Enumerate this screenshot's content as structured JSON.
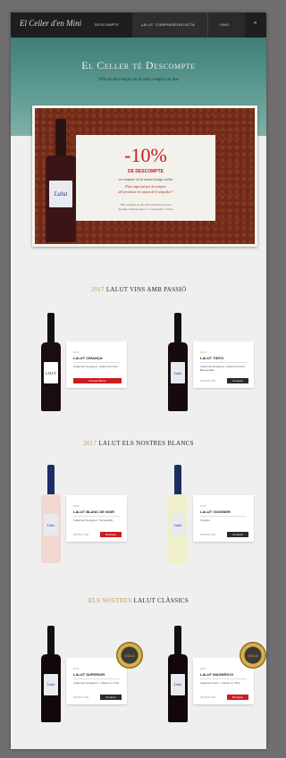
{
  "header": {
    "logo": "El Celler d'en Mini",
    "nav": [
      "DESCOMPTE",
      "LALUT",
      "COMPRAR",
      "CONTACTA",
      "VINS"
    ],
    "more": "»"
  },
  "hero": {
    "title": "El Celler té Descompte",
    "subtitle": "10% de descompte en la seva compra on line"
  },
  "promo": {
    "bottle_label": "Lalut",
    "percent": "-10%",
    "headline": "DE DESCOMPTE",
    "line1": "en comprar en la nostra botiga online",
    "line2": "Preu especial per la compra",
    "line3": "del producte en caixes de 6 ampolles*",
    "fine1": "*Els comptes no són fets mai sobre el preu",
    "fine2": "Sumats 2 Descomptes = 1 Comanda = 1 Preu"
  },
  "sections": [
    {
      "year": "2017",
      "title": "LALUT VINS AMB PASSIÓ",
      "products": [
        {
          "year": "2013",
          "name": "LALUT CRIANÇA",
          "grapes": "Cabernet Sauvignon, Cabernet Franc",
          "button": "Paraula Beure"
        },
        {
          "year": "2014",
          "name": "LALUT TINTO",
          "grapes": "Cabernet Sauvignon, Cabernet Franc, Bosquedilla",
          "price": "13,35 € / IVA",
          "button": "Comprar"
        }
      ]
    },
    {
      "year": "2017",
      "title": "LALUT ELS NOSTRES BLANCS",
      "products": [
        {
          "year": "2016",
          "name": "LALUT BLANC DE NOIR",
          "grapes": "Cabernet Sauvignon, Tempranillo",
          "price": "12,85 € / IVA",
          "button": "Boutique"
        },
        {
          "year": "2016",
          "name": "LALUT VIOGNIER",
          "grapes": "Viognier",
          "price": "13,85 € / IVA",
          "button": "Comprar"
        }
      ]
    },
    {
      "year": "ELS NOSTRES",
      "title": "LALUT CLÀSSICS",
      "products": [
        {
          "year": "2012",
          "name": "LALUT SUPERIOR",
          "grapes": "Cabernet Sauvignon, y Merlot en Tinto",
          "price": "16,50 € / IVA",
          "button": "Comprar",
          "medal": "GOLD"
        },
        {
          "year": "2011",
          "name": "LALUT MAGNÍFICO",
          "grapes": "Cabernet Franc, y Merlot en Tinto",
          "price": "18,75 € / IVA",
          "button": "Boutique",
          "medal": "GOLD"
        }
      ]
    }
  ],
  "colors": {
    "accent_red": "#cc1c24",
    "gold": "#c79a4b",
    "teal": "#5d9b93",
    "dark": "#1e1e1e"
  }
}
